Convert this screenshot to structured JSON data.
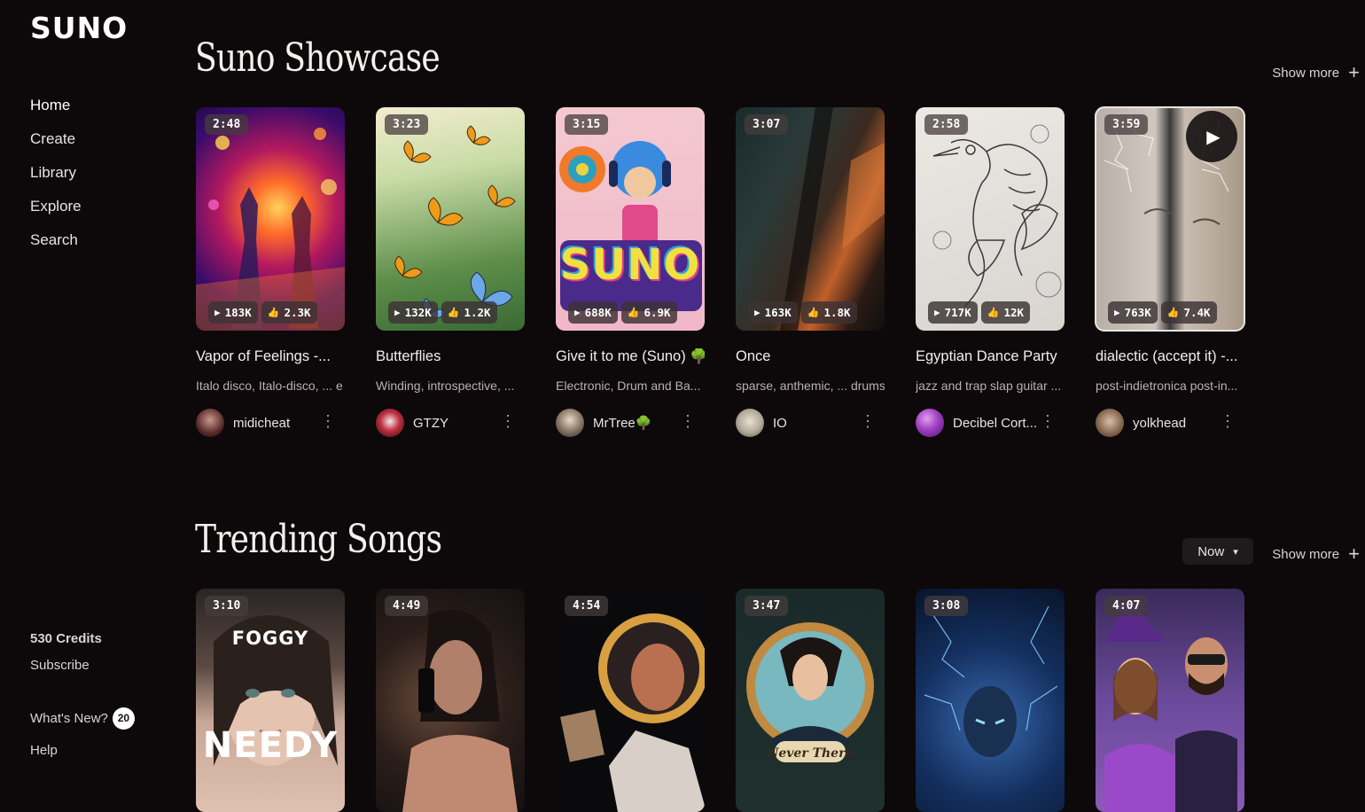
{
  "brand": "SUNO",
  "nav": [
    {
      "label": "Home"
    },
    {
      "label": "Create"
    },
    {
      "label": "Library"
    },
    {
      "label": "Explore"
    },
    {
      "label": "Search"
    }
  ],
  "sidebar_bottom": {
    "credits": "530 Credits",
    "subscribe": "Subscribe",
    "whats_new": "What's New?",
    "whats_new_count": "20",
    "help": "Help"
  },
  "showcase": {
    "title": "Suno Showcase",
    "show_more": "Show more",
    "songs": [
      {
        "duration": "2:48",
        "plays": "183K",
        "likes": "2.3K",
        "title": "Vapor of Feelings -...",
        "tags": "Italo disco, Italo-disco, ... e",
        "author": "midicheat"
      },
      {
        "duration": "3:23",
        "plays": "132K",
        "likes": "1.2K",
        "title": "Butterflies",
        "tags": "Winding, introspective, ...",
        "author": "GTZY"
      },
      {
        "duration": "3:15",
        "plays": "688K",
        "likes": "6.9K",
        "title": "Give it to me (Suno) 🌳",
        "tags": "Electronic, Drum and Ba...",
        "author": "MrTree🌳",
        "cover_text": "SUNO"
      },
      {
        "duration": "3:07",
        "plays": "163K",
        "likes": "1.8K",
        "title": "Once",
        "tags": "sparse, anthemic, ... drums",
        "author": "IO"
      },
      {
        "duration": "2:58",
        "plays": "717K",
        "likes": "12K",
        "title": "Egyptian Dance Party",
        "tags": "jazz and trap slap guitar ...",
        "author": "Decibel Cort..."
      },
      {
        "duration": "3:59",
        "plays": "763K",
        "likes": "7.4K",
        "title": "dialectic (accept it) -...",
        "tags": "post-indietronica post-in...",
        "author": "yolkhead"
      }
    ]
  },
  "trending": {
    "title": "Trending Songs",
    "filter": "Now",
    "show_more": "Show more",
    "songs": [
      {
        "duration": "3:10",
        "cover_top": "FOGGY",
        "cover_bottom": "NEEDY"
      },
      {
        "duration": "4:49"
      },
      {
        "duration": "4:54"
      },
      {
        "duration": "3:47",
        "cover_bottom": "Never There"
      },
      {
        "duration": "3:08"
      },
      {
        "duration": "4:07"
      }
    ]
  },
  "icons": {
    "play": "play-icon",
    "like": "thumbs-up-icon",
    "more": "more-vertical-icon",
    "plus": "plus-icon",
    "chevron": "chevron-down-icon"
  }
}
